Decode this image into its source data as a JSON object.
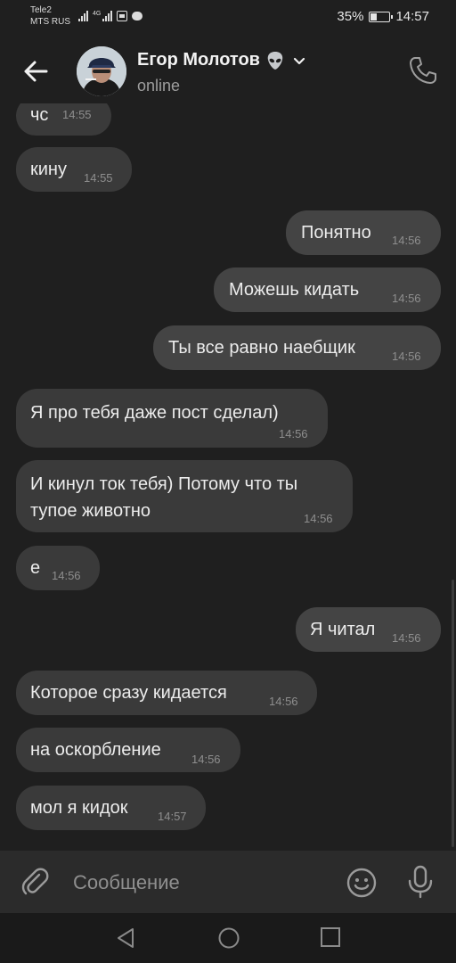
{
  "status_bar": {
    "carrier1": "Tele2",
    "carrier2": "MTS RUS",
    "network": "4G",
    "battery": "35%",
    "battery_level": 0.35,
    "time": "14:57"
  },
  "header": {
    "name": "Егор Молотов",
    "status": "online"
  },
  "messages": [
    {
      "dir": "in",
      "text": "чс",
      "time": "14:55"
    },
    {
      "dir": "in",
      "text": "кину",
      "time": "14:55"
    },
    {
      "dir": "out",
      "text": "Понятно",
      "time": "14:56"
    },
    {
      "dir": "out",
      "text": "Можешь кидать",
      "time": "14:56"
    },
    {
      "dir": "out",
      "text": "Ты все равно наебщик",
      "time": "14:56"
    },
    {
      "dir": "in",
      "text": "Я про тебя даже пост сделал)",
      "time": "14:56"
    },
    {
      "dir": "in",
      "text": "И кинул ток тебя) Потому что ты",
      "text2": "тупое животно",
      "time": "14:56"
    },
    {
      "dir": "in",
      "text": "е",
      "time": "14:56"
    },
    {
      "dir": "out",
      "text": "Я читал",
      "time": "14:56"
    },
    {
      "dir": "in",
      "text": "Которое сразу кидается",
      "time": "14:56"
    },
    {
      "dir": "in",
      "text": "на оскорбление",
      "time": "14:56"
    },
    {
      "dir": "in",
      "text": "мол я кидок",
      "time": "14:57"
    }
  ],
  "composer": {
    "placeholder": "Сообщение"
  },
  "colors": {
    "background": "#1f1f1f",
    "bubble_in": "#3a3a3a",
    "bubble_out": "#444444",
    "accent": "#ffffff"
  }
}
